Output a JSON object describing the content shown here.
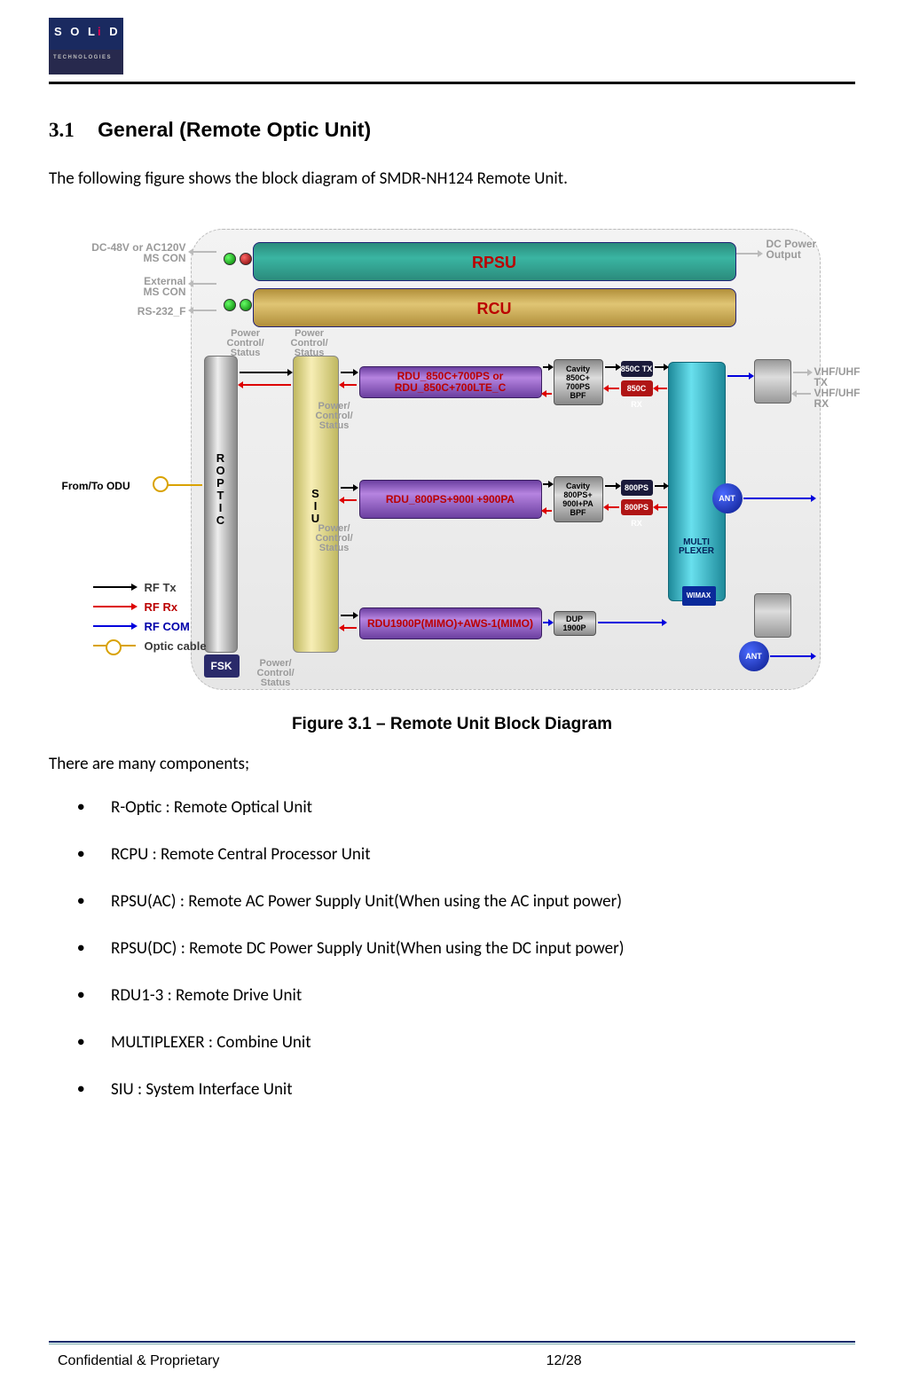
{
  "logo": {
    "top_pre": "S O L",
    "top_i": "i",
    "top_post": " D",
    "bottom": "TECHNOLOGIES"
  },
  "section": {
    "num": "3.1",
    "title": "General (Remote Optic Unit)"
  },
  "intro": "The following figure shows the block diagram of SMDR-NH124 Remote Unit.",
  "caption": "Figure 3.1 – Remote Unit Block Diagram",
  "components_intro": "There are many components;",
  "components": [
    "R-Optic : Remote Optical Unit",
    "RCPU : Remote Central Processor Unit",
    "RPSU(AC) :    Remote AC Power Supply Unit(When using the AC input power)",
    "RPSU(DC) :    Remote DC Power Supply Unit(When using the DC input power)",
    "RDU1-3 : Remote Drive Unit",
    "MULTIPLEXER : Combine Unit",
    "SIU : System Interface Unit"
  ],
  "footer": {
    "left": "Confidential & Proprietary",
    "page": "12/28"
  },
  "diagram": {
    "rpsu": "RPSU",
    "rcu": "RCU",
    "roptic": "R\nO\nP\nT\nI\nC",
    "siu": "S\nI\nU",
    "fsk": "FSK",
    "rdu1": "RDU_850C+700PS or RDU_850C+700LTE_C",
    "rdu2": "RDU_800PS+900I +900PA",
    "rdu3": "RDU1900P(MIMO)+AWS-1(MIMO)",
    "cav1": "Cavity\n850C+\n700PS\nBPF",
    "cav2": "Cavity\n800PS+\n900I+PA\nBPF",
    "dup": "DUP\n1900P",
    "tx1": "850C TX",
    "rx1": "850C RX",
    "tx2": "800PS TX",
    "rx2": "800PS RX",
    "mplex": "MULTI\nPLEXER",
    "ant": "ANT",
    "wimax": "WIMAX",
    "side_left1": "DC-48V or AC120V\nMS CON",
    "side_left2": "External\nMS CON",
    "side_left3": "RS-232_F",
    "side_right_top": "DC Power\nOutput",
    "side_right_vhf1": "VHF/UHF TX",
    "side_right_vhf2": "VHF/UHF RX",
    "from_to": "From/To ODU",
    "pcs": "Power\nControl/\nStatus",
    "pcs_slash": "Power/\nControl/\nStatus",
    "legend": {
      "rftx": "RF Tx",
      "rfrx": "RF Rx",
      "rfcom": "RF COM",
      "optic": "Optic cable"
    }
  }
}
